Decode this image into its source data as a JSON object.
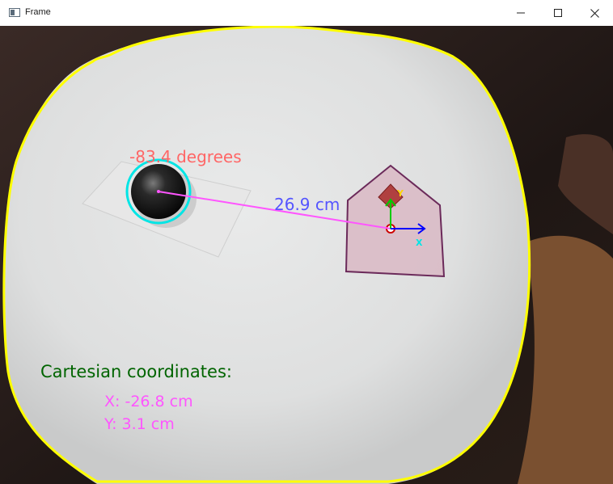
{
  "window": {
    "title": "Frame"
  },
  "overlay": {
    "angle_label": "-83.4 degrees",
    "distance_label": "26.9 cm",
    "axis_y_label": "Y",
    "axis_x_label": "X",
    "coords_heading": "Cartesian coordinates:",
    "coord_x": "X: -26.8 cm",
    "coord_y": "Y: 3.1 cm"
  },
  "colors": {
    "table_boundary": "#ffff00",
    "ball_circle": "#00e5e5",
    "vector_line": "#ff55ff",
    "angle_text": "#ff6666",
    "distance_text": "#5555ff",
    "robot_outline": "#6b2a5a",
    "axis_y": "#00cc00",
    "axis_x": "#0000ff",
    "heading_text": "#006400",
    "coords_text": "#ff55ff"
  },
  "icons": {
    "minimize": "minimize-icon",
    "maximize": "maximize-icon",
    "close": "close-icon"
  }
}
